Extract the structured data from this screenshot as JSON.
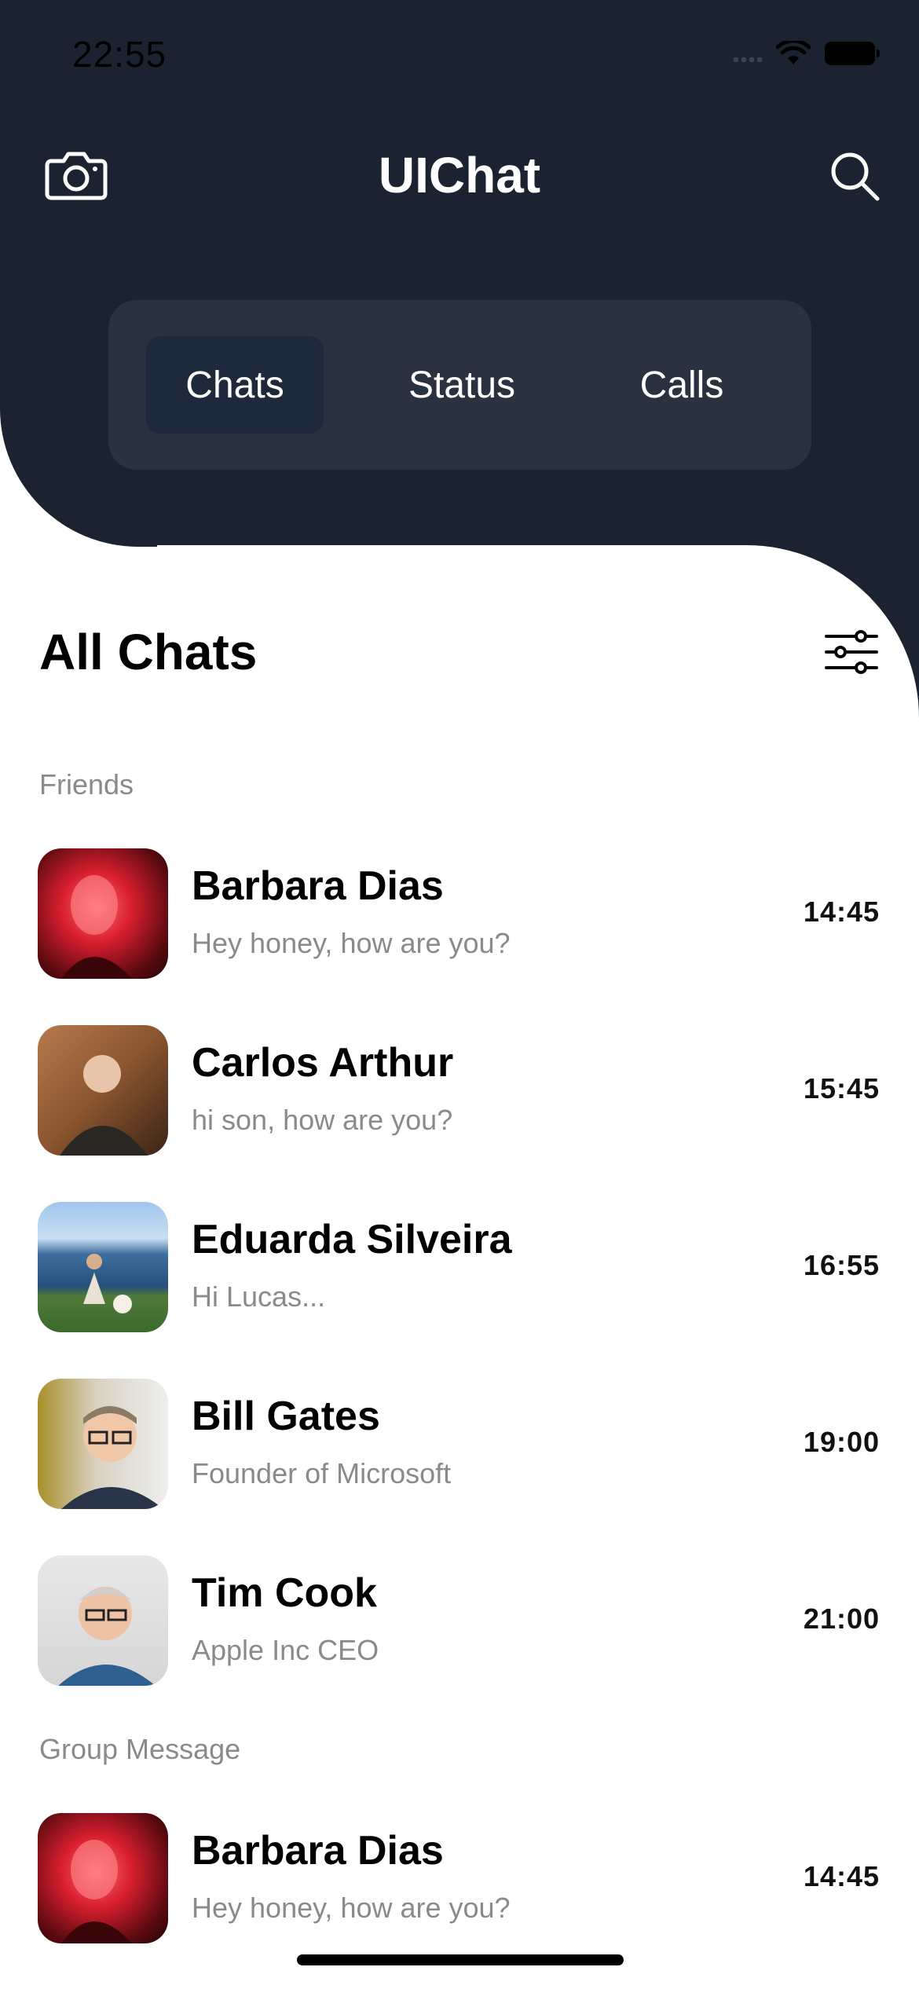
{
  "status_bar": {
    "time": "22:55"
  },
  "header": {
    "title": "UIChat",
    "tabs": [
      {
        "label": "Chats",
        "selected": true
      },
      {
        "label": "Status",
        "selected": false
      },
      {
        "label": "Calls",
        "selected": false
      }
    ]
  },
  "main": {
    "section_title": "All Chats",
    "groups": [
      {
        "label": "Friends",
        "chats": [
          {
            "name": "Barbara Dias",
            "message": "Hey honey, how are you?",
            "time": "14:45"
          },
          {
            "name": "Carlos Arthur",
            "message": "hi son, how are you?",
            "time": "15:45"
          },
          {
            "name": "Eduarda Silveira",
            "message": "Hi Lucas...",
            "time": "16:55"
          },
          {
            "name": "Bill Gates",
            "message": "Founder of Microsoft",
            "time": "19:00"
          },
          {
            "name": "Tim Cook",
            "message": "Apple Inc CEO",
            "time": "21:00"
          }
        ]
      },
      {
        "label": "Group Message",
        "chats": [
          {
            "name": "Barbara Dias",
            "message": "Hey honey, how are you?",
            "time": "14:45"
          }
        ]
      }
    ]
  },
  "colors": {
    "header_bg": "#1b2230",
    "segment_bg": "#2a3240",
    "segment_selected": "#1e2a3c",
    "muted_text": "#8a8a8e"
  },
  "icons": {
    "camera": "camera-icon",
    "search": "search-icon",
    "filter": "sliders-icon"
  }
}
